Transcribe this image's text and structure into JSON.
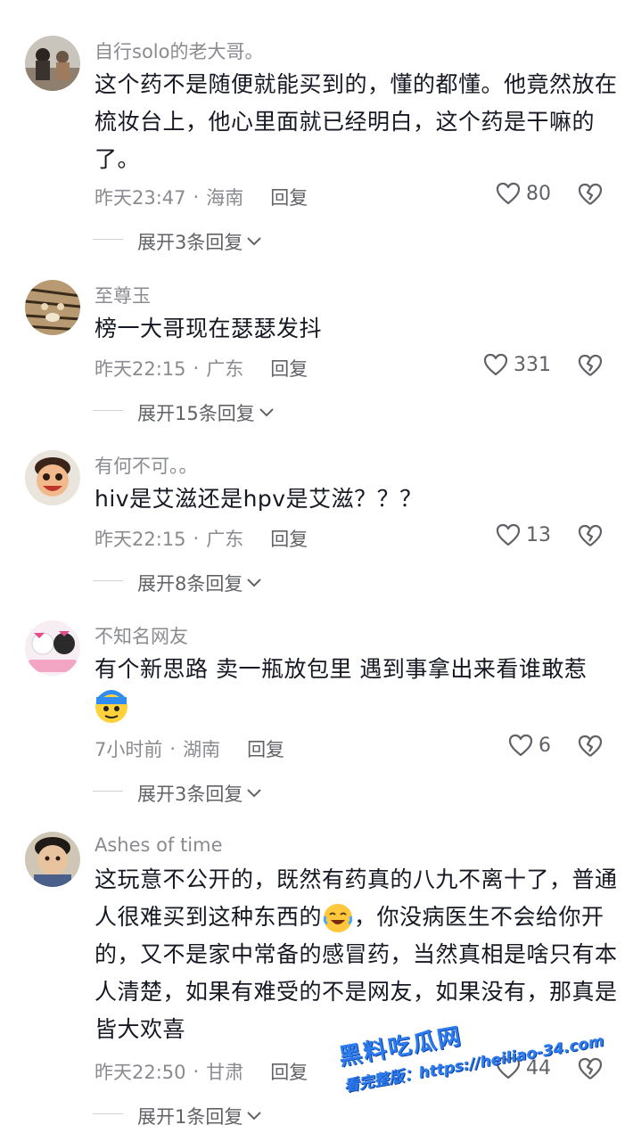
{
  "comments": [
    {
      "username": "自行solo的老大哥。",
      "text": "这个药不是随便就能买到的，懂的都懂。他竟然放在梳妆台上，他心里面就已经明白，这个药是干嘛的了。",
      "time": "昨天23:47",
      "location": "海南",
      "reply_label": "回复",
      "likes": "80",
      "expand_label": "展开3条回复"
    },
    {
      "username": "至尊玉",
      "text": "榜一大哥现在瑟瑟发抖",
      "time": "昨天22:15",
      "location": "广东",
      "reply_label": "回复",
      "likes": "331",
      "expand_label": "展开15条回复"
    },
    {
      "username": "有何不可。。",
      "text": "hiv是艾滋还是hpv是艾滋？？？",
      "time": "昨天22:15",
      "location": "广东",
      "reply_label": "回复",
      "likes": "13",
      "expand_label": "展开8条回复"
    },
    {
      "username": "不知名网友",
      "text": "有个新思路 卖一瓶放包里 遇到事拿出来看谁敢惹",
      "time": "7小时前",
      "location": "湖南",
      "reply_label": "回复",
      "likes": "6",
      "expand_label": "展开3条回复"
    },
    {
      "username": "Ashes of time",
      "text_part1": "这玩意不公开的，既然有药真的八九不离十了，普通人很难买到这种东西的",
      "text_part2": "，你没病医生不会给你开的，又不是家中常备的感冒药，当然真相是啥只有本人清楚，如果有难受的不是网友，如果没有，那真是皆大欢喜",
      "time": "昨天22:50",
      "location": "甘肃",
      "reply_label": "回复",
      "likes": "44",
      "expand_label": "展开1条回复"
    }
  ],
  "separator": "·",
  "watermark": {
    "line1": "黑料吃瓜网",
    "line2": "看完整版：https://heiliao-34.com"
  },
  "colors": {
    "text": "#161823",
    "secondary": "#8a8b91",
    "watermark": "#2d7df0"
  }
}
